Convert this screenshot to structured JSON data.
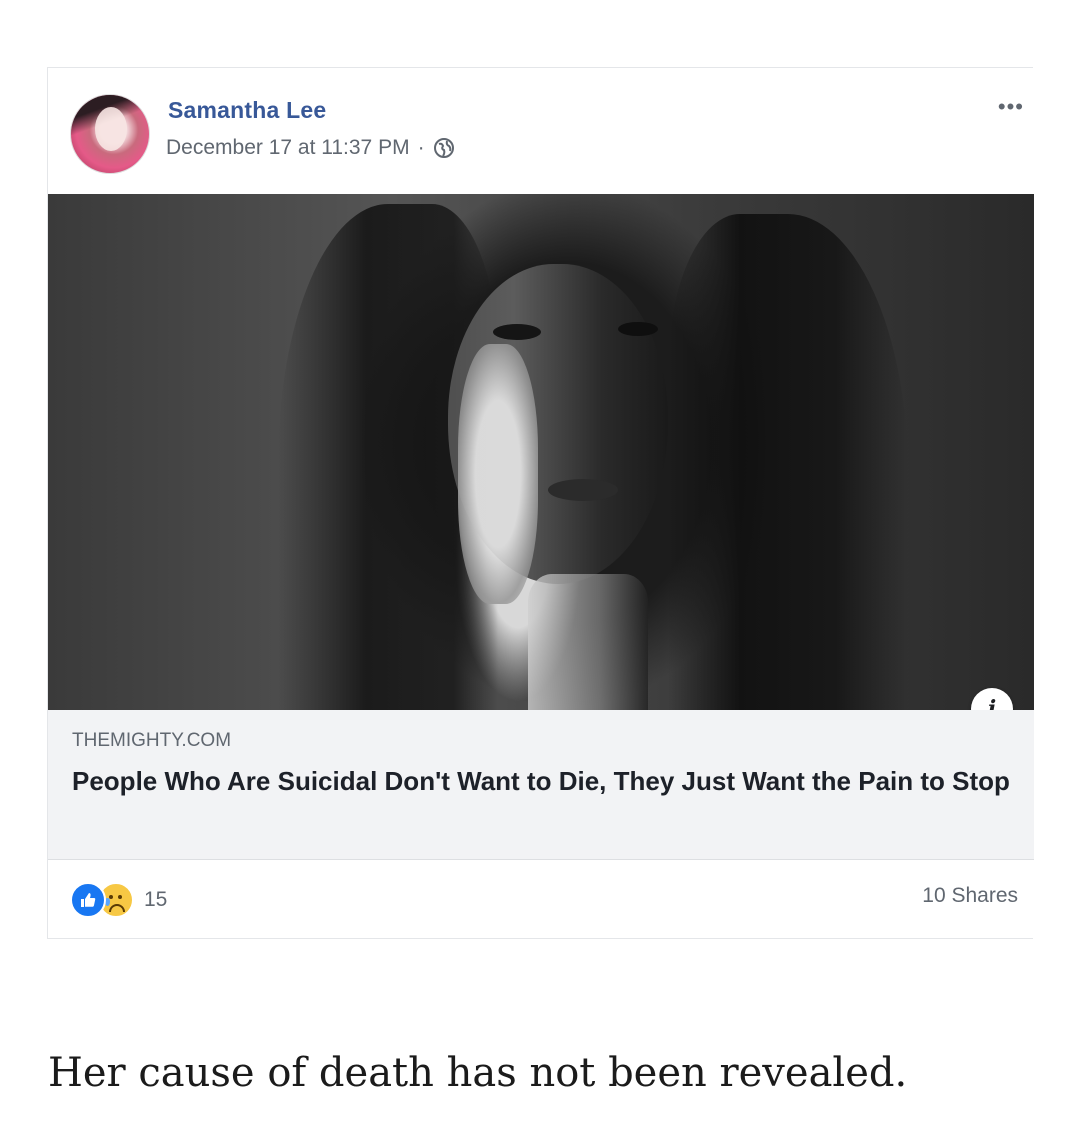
{
  "post": {
    "author": "Samantha Lee",
    "timestamp": "December 17 at 11:37 PM",
    "separator": "·",
    "privacy_icon": "globe-icon",
    "more_icon": "ellipsis-icon"
  },
  "link": {
    "domain": "THEMIGHTY.COM",
    "headline": "People Who Are Suicidal Don't Want to Die, They Just Want the Pain to Stop",
    "info_icon": "i"
  },
  "footer": {
    "reaction_icons": [
      "like-icon",
      "sad-icon"
    ],
    "reaction_count": "15",
    "shares": "10 Shares"
  },
  "caption": "Her cause of death has not been revealed.",
  "colors": {
    "author": "#385898",
    "secondary_text": "#606770",
    "link_background": "#f2f3f5",
    "like": "#1877f2",
    "sad": "#f7c844"
  }
}
